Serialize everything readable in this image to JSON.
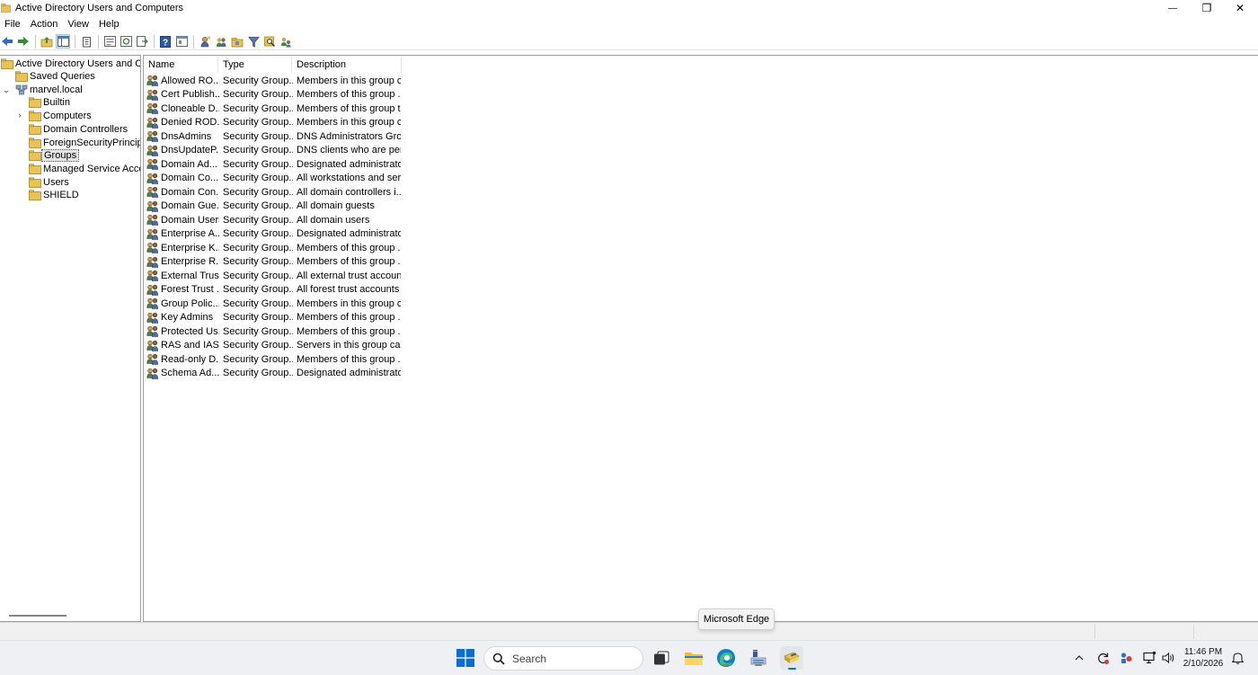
{
  "window": {
    "title": "Active Directory Users and Computers",
    "minimize_glyph": "—",
    "restore_glyph": "❐",
    "close_glyph": "✕"
  },
  "menu": [
    "File",
    "Action",
    "View",
    "Help"
  ],
  "toolbar": {
    "icons": [
      "back-icon",
      "forward-icon",
      "up-folder-icon",
      "show-hide-tree-icon",
      "delete-icon",
      "properties-icon",
      "refresh-icon",
      "export-list-icon",
      "help-icon",
      "mmc-console-icon",
      "new-user-icon",
      "new-group-icon",
      "new-ou-icon",
      "filter-icon",
      "find-icon",
      "add-to-group-icon",
      "delegate-icon"
    ]
  },
  "tree": {
    "root": "Active Directory Users and Com",
    "items": [
      {
        "label": "Saved Queries",
        "level": 1,
        "icon": "folder-icon"
      },
      {
        "label": "marvel.local",
        "level": 1,
        "icon": "domain-icon",
        "expanded": true
      },
      {
        "label": "Builtin",
        "level": 2,
        "icon": "folder-icon"
      },
      {
        "label": "Computers",
        "level": 2,
        "icon": "folder-icon",
        "collapsed": true
      },
      {
        "label": "Domain Controllers",
        "level": 2,
        "icon": "folder-icon"
      },
      {
        "label": "ForeignSecurityPrincipals",
        "level": 2,
        "icon": "folder-icon"
      },
      {
        "label": "Groups",
        "level": 2,
        "icon": "folder-icon",
        "selected": true
      },
      {
        "label": "Managed Service Accour",
        "level": 2,
        "icon": "folder-icon"
      },
      {
        "label": "Users",
        "level": 2,
        "icon": "folder-icon"
      },
      {
        "label": "SHIELD",
        "level": 2,
        "icon": "folder-icon"
      }
    ]
  },
  "list": {
    "columns": [
      "Name",
      "Type",
      "Description"
    ],
    "rows": [
      {
        "name": "Allowed RO...",
        "type": "Security Group...",
        "description": "Members in this group c..."
      },
      {
        "name": "Cert Publish...",
        "type": "Security Group...",
        "description": "Members of this group ..."
      },
      {
        "name": "Cloneable D...",
        "type": "Security Group...",
        "description": "Members of this group t..."
      },
      {
        "name": "Denied ROD...",
        "type": "Security Group...",
        "description": "Members in this group c..."
      },
      {
        "name": "DnsAdmins",
        "type": "Security Group...",
        "description": "DNS Administrators Gro..."
      },
      {
        "name": "DnsUpdateP...",
        "type": "Security Group...",
        "description": "DNS clients who are per..."
      },
      {
        "name": "Domain Ad...",
        "type": "Security Group...",
        "description": "Designated administrato..."
      },
      {
        "name": "Domain Co...",
        "type": "Security Group...",
        "description": "All workstations and ser..."
      },
      {
        "name": "Domain Con...",
        "type": "Security Group...",
        "description": "All domain controllers i..."
      },
      {
        "name": "Domain Gue...",
        "type": "Security Group...",
        "description": "All domain guests"
      },
      {
        "name": "Domain Users",
        "type": "Security Group...",
        "description": "All domain users"
      },
      {
        "name": "Enterprise A...",
        "type": "Security Group...",
        "description": "Designated administrato..."
      },
      {
        "name": "Enterprise K...",
        "type": "Security Group...",
        "description": "Members of this group ..."
      },
      {
        "name": "Enterprise R...",
        "type": "Security Group...",
        "description": "Members of this group ..."
      },
      {
        "name": "External Trus...",
        "type": "Security Group...",
        "description": "All external trust accoun..."
      },
      {
        "name": "Forest Trust ...",
        "type": "Security Group...",
        "description": "All forest trust accounts ..."
      },
      {
        "name": "Group Polic...",
        "type": "Security Group...",
        "description": "Members in this group c..."
      },
      {
        "name": "Key Admins",
        "type": "Security Group...",
        "description": "Members of this group ..."
      },
      {
        "name": "Protected Us...",
        "type": "Security Group...",
        "description": "Members of this group ..."
      },
      {
        "name": "RAS and IAS ...",
        "type": "Security Group...",
        "description": "Servers in this group can..."
      },
      {
        "name": "Read-only D...",
        "type": "Security Group...",
        "description": "Members of this group ..."
      },
      {
        "name": "Schema Ad...",
        "type": "Security Group...",
        "description": "Designated administrato..."
      }
    ]
  },
  "tooltip": "Microsoft Edge",
  "taskbar": {
    "search_placeholder": "Search",
    "apps": [
      "start-icon",
      "search-icon",
      "task-view-icon",
      "file-explorer-icon",
      "edge-icon",
      "server-manager-icon",
      "ad-users-computers-icon"
    ],
    "tray": [
      "chevron-up-icon",
      "sync-icon",
      "people-icon",
      "network-icon",
      "volume-icon"
    ],
    "time": "11:46 PM",
    "date": "2/10/2026"
  },
  "colors": {
    "folder": "#e8c458",
    "selection": "#e5e5e5",
    "windows_blue": "#0078d4",
    "back_arrow": "#2a6fc9",
    "forward_arrow": "#3a8a3a"
  }
}
